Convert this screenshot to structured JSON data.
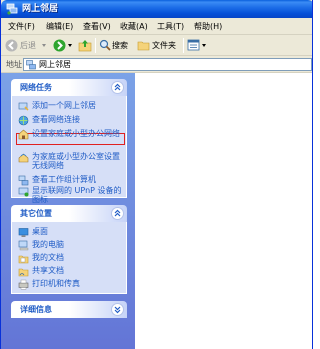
{
  "window": {
    "title": "网上邻居"
  },
  "menu": {
    "items": [
      "文件(F)",
      "编辑(E)",
      "查看(V)",
      "收藏(A)",
      "工具(T)",
      "帮助(H)"
    ]
  },
  "toolbar": {
    "back_label": "后退",
    "search_label": "搜索",
    "folders_label": "文件夹"
  },
  "address": {
    "label": "地址(D)",
    "value": "网上邻居"
  },
  "panels": {
    "network_tasks": {
      "title": "网络任务",
      "items": [
        "添加一个网上邻居",
        "查看网络连接",
        "设置家庭或小型办公网络",
        "为家庭或小型办公室设置无线网络",
        "查看工作组计算机",
        "显示联网的 UPnP 设备的图标"
      ]
    },
    "other_places": {
      "title": "其它位置",
      "items": [
        "桌面",
        "我的电脑",
        "我的文档",
        "共享文档",
        "打印机和传真"
      ]
    },
    "details": {
      "title": "详细信息"
    }
  },
  "colors": {
    "titlebar": "#0A5FDC",
    "taskpane": "#7BA2E7",
    "link": "#215DC6",
    "highlight": "#E02020"
  }
}
